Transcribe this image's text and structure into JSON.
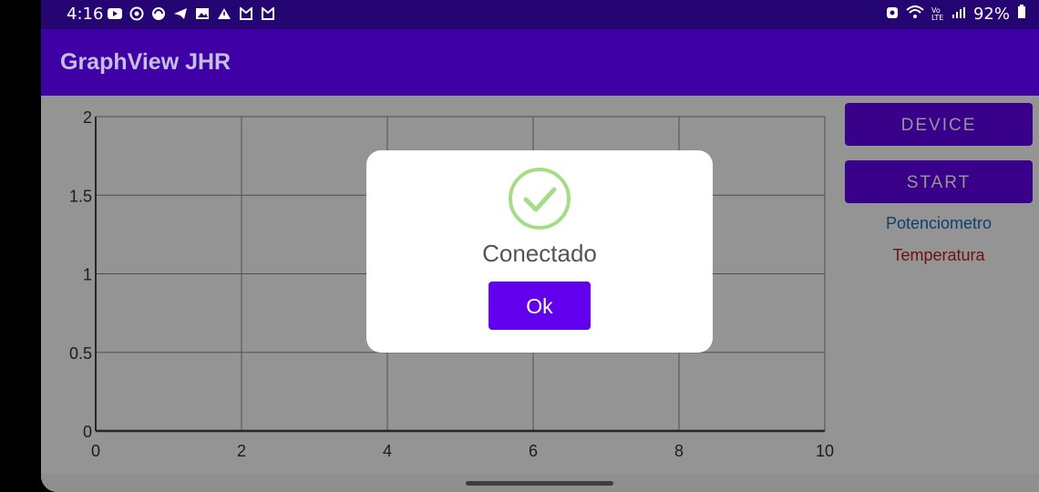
{
  "status": {
    "time": "4:16",
    "battery": "92%",
    "left_icons": [
      "youtube-icon",
      "target-icon",
      "sync-icon",
      "telegram-icon",
      "image-icon",
      "warning-icon",
      "mi-icon",
      "mi-icon"
    ],
    "right_icons": [
      "alarm-icon",
      "wifi-icon",
      "volte-icon",
      "signal-icon",
      "battery-icon"
    ],
    "network_label": "Vo LTE"
  },
  "app": {
    "title": "GraphView JHR"
  },
  "buttons": {
    "device": "DEVICE",
    "start": "START"
  },
  "legend": [
    {
      "label": "Potenciometro",
      "color": "#1a6eb3"
    },
    {
      "label": "Temperatura",
      "color": "#bb2020"
    }
  ],
  "chart_data": {
    "type": "line",
    "x_ticks": [
      "0",
      "2",
      "4",
      "6",
      "8",
      "10"
    ],
    "y_ticks": [
      "0",
      "0.5",
      "1",
      "1.5",
      "2"
    ],
    "xlim": [
      0,
      10
    ],
    "ylim": [
      0,
      2
    ],
    "grid": true,
    "series": [
      {
        "name": "Potenciometro",
        "values": []
      },
      {
        "name": "Temperatura",
        "values": []
      }
    ]
  },
  "dialog": {
    "title": "Conectado",
    "ok_label": "Ok",
    "icon": "check-circle-icon",
    "icon_color": "#a5dc86"
  },
  "colors": {
    "appbar": "#3f00a6",
    "statusbar": "#250571",
    "accent": "#6200ee"
  }
}
